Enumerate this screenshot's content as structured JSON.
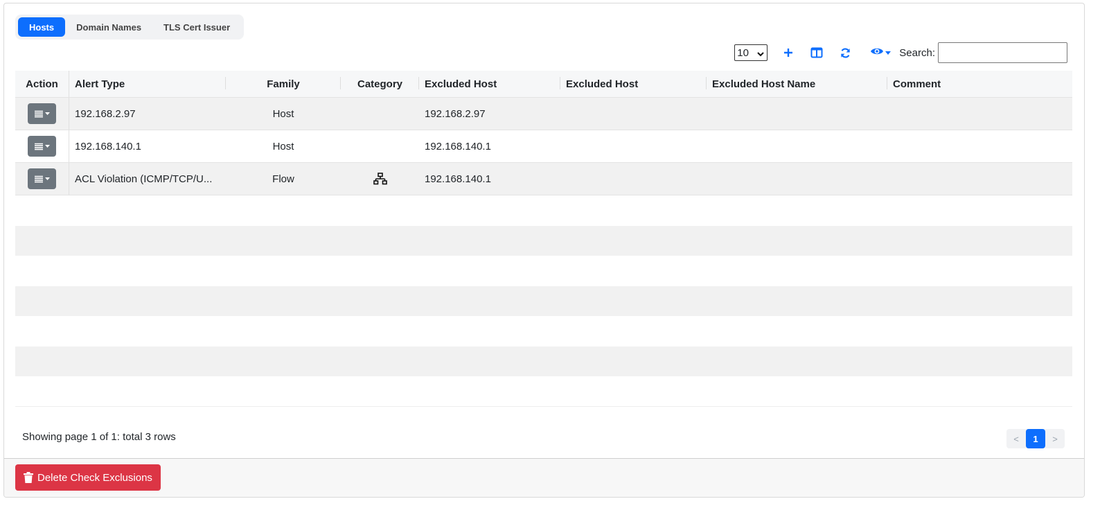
{
  "tabs": [
    {
      "label": "Hosts",
      "active": true
    },
    {
      "label": "Domain Names",
      "active": false
    },
    {
      "label": "TLS Cert Issuer",
      "active": false
    }
  ],
  "toolbar": {
    "page_size": "10",
    "search_label": "Search:",
    "search_value": "",
    "accent_color": "#0d6efd"
  },
  "table": {
    "headers": [
      "Action",
      "Alert Type",
      "Family",
      "Category",
      "Excluded Host",
      "Excluded Host",
      "Excluded Host Name",
      "Comment"
    ],
    "rows": [
      {
        "alert_type": "192.168.2.97",
        "family": "Host",
        "category_icon": "",
        "excluded_host": "192.168.2.97",
        "excluded_host_2": "",
        "excluded_host_name": "",
        "comment": ""
      },
      {
        "alert_type": "192.168.140.1",
        "family": "Host",
        "category_icon": "",
        "excluded_host": "192.168.140.1",
        "excluded_host_2": "",
        "excluded_host_name": "",
        "comment": ""
      },
      {
        "alert_type": "ACL Violation (ICMP/TCP/U...",
        "family": "Flow",
        "category_icon": "network-icon",
        "excluded_host": "192.168.140.1",
        "excluded_host_2": "",
        "excluded_host_name": "",
        "comment": ""
      }
    ]
  },
  "footer": {
    "info": "Showing page 1 of 1: total 3 rows",
    "pager": {
      "prev": "<",
      "current": "1",
      "next": ">"
    }
  },
  "actions": {
    "delete_label": "Delete Check Exclusions",
    "delete_color": "#dc3545"
  }
}
